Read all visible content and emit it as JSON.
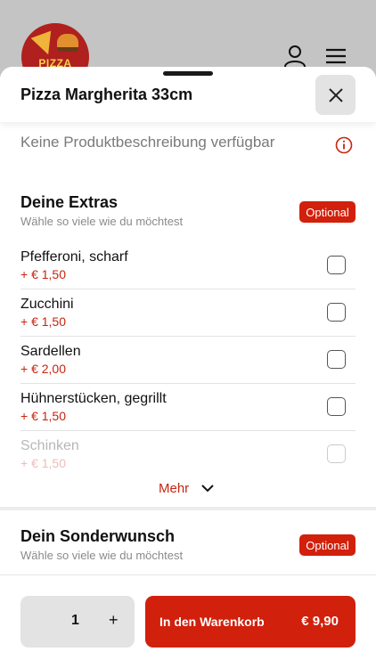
{
  "header": {
    "logo_text": "PIZZA",
    "user_icon": "user-icon",
    "menu_icon": "hamburger-menu-icon"
  },
  "sheet": {
    "title": "Pizza Margherita 33cm",
    "close_icon": "close-icon",
    "description": "Keine Produktbeschreibung verfügbar",
    "info_icon": "info-icon"
  },
  "extras": {
    "title": "Deine Extras",
    "subtitle": "Wähle so viele wie du möchtest",
    "badge": "Optional",
    "items": [
      {
        "name": "Pfefferoni, scharf",
        "price": "+ € 1,50",
        "checked": false
      },
      {
        "name": "Zucchini",
        "price": "+ € 1,50",
        "checked": false
      },
      {
        "name": "Sardellen",
        "price": "+ € 2,00",
        "checked": false
      },
      {
        "name": "Hühnerstücken, gegrillt",
        "price": "+ € 1,50",
        "checked": false
      },
      {
        "name": "Schinken",
        "price": "+ € 1,50",
        "checked": false
      }
    ],
    "more_label": "Mehr"
  },
  "special_request": {
    "title": "Dein Sonderwunsch",
    "subtitle": "Wähle so viele wie du möchtest",
    "badge": "Optional"
  },
  "footer": {
    "quantity": "1",
    "plus_label": "+",
    "cart_label": "In den Warenkorb",
    "cart_price": "€ 9,90"
  },
  "colors": {
    "accent": "#d1200b",
    "price": "#c8240f"
  }
}
